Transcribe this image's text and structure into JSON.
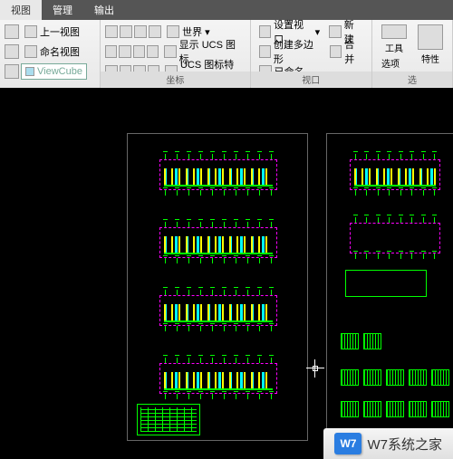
{
  "tabs": {
    "view": "视图",
    "manage": "管理",
    "output": "输出"
  },
  "panel1": {
    "prev_view": "上一视图",
    "named_view": "命名视图",
    "viewcube": "ViewCube",
    "title": ""
  },
  "panel2": {
    "world": "世界",
    "show_ucs_icon": "显示 UCS 图标",
    "ucs_properties": "UCS 图标特性",
    "title": "坐标"
  },
  "panel3": {
    "set_viewport": "设置视口",
    "create_poly": "创建多边形",
    "named": "已命名",
    "new": "新建",
    "merge": "合并",
    "title": "视口"
  },
  "panel4": {
    "tools": "工具",
    "options": "选项板",
    "prop": "特性",
    "title": "选"
  },
  "logo": {
    "badge": "W7",
    "text": "W7系统之家"
  }
}
